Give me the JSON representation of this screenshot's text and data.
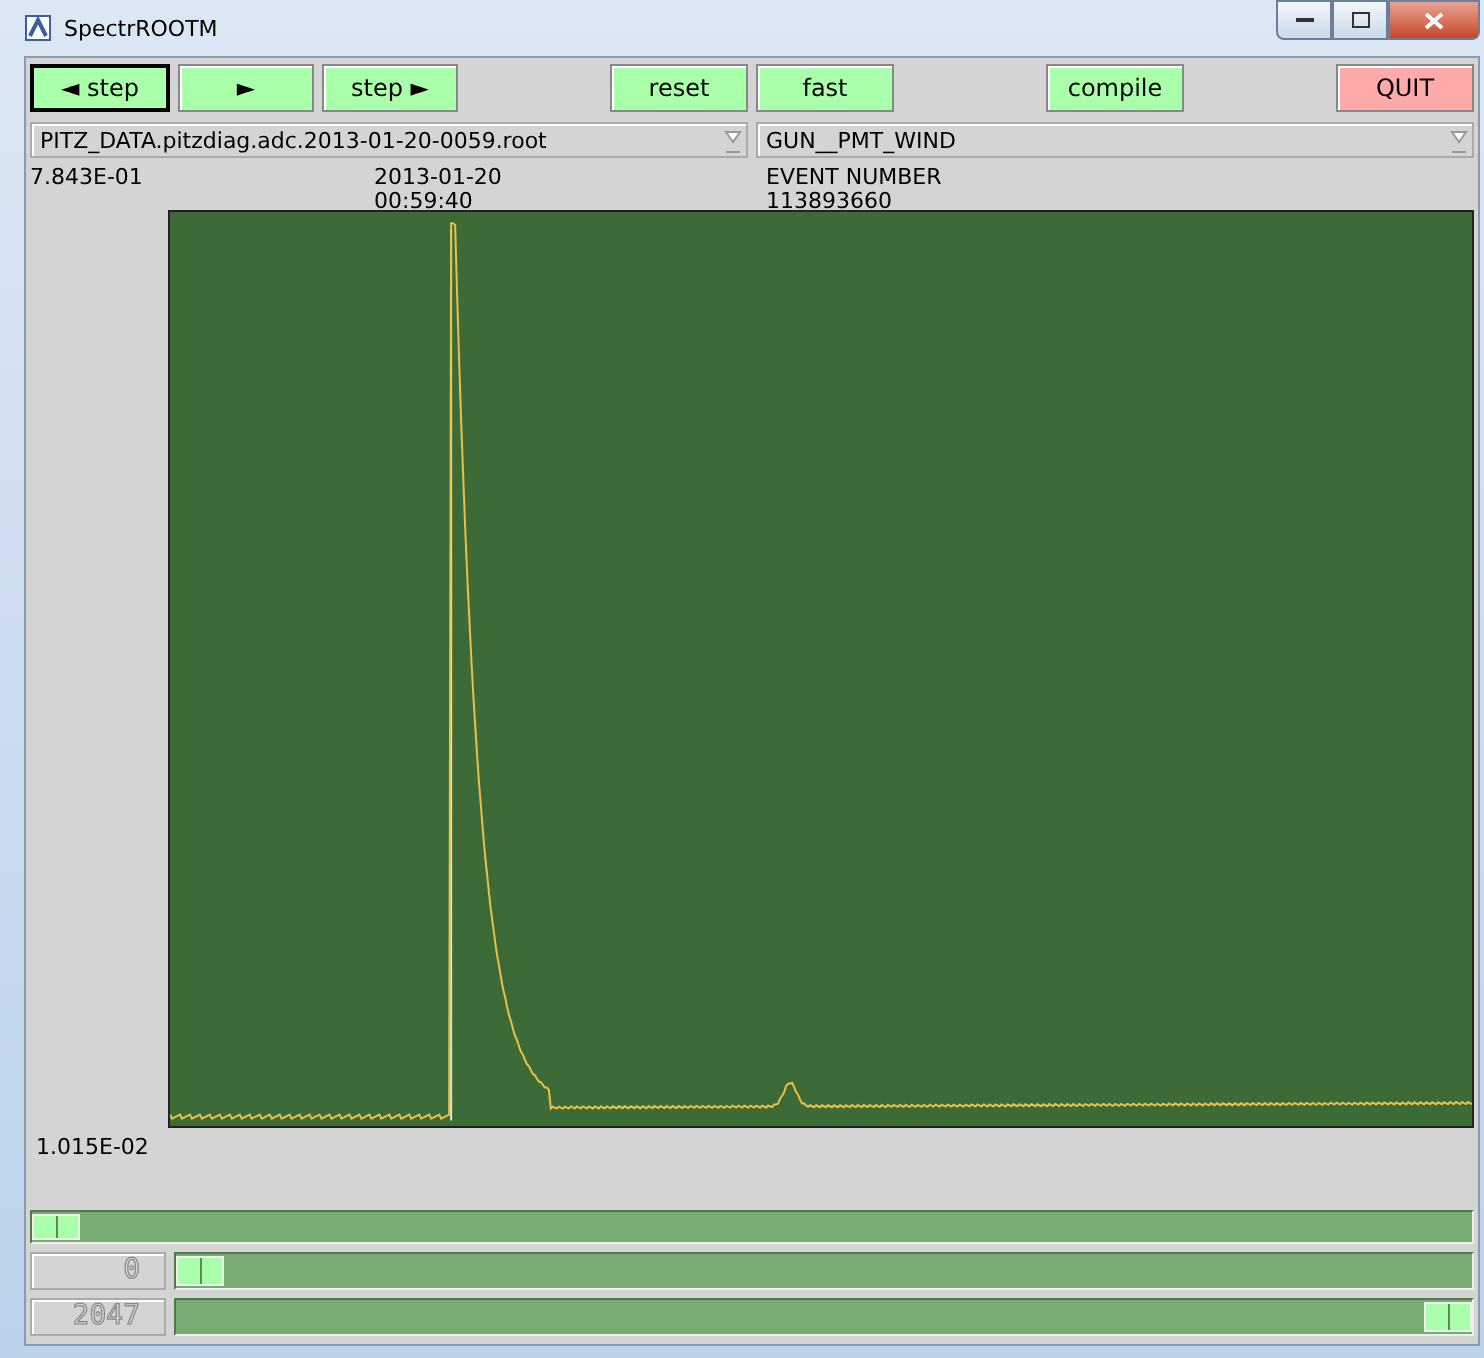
{
  "window": {
    "title": "SpectrROOTM"
  },
  "button_groups": [
    [
      {
        "label": "◄ step",
        "kind": "normal",
        "selected": true
      },
      {
        "label": "►",
        "kind": "normal",
        "selected": false
      },
      {
        "label": "step ►",
        "kind": "normal",
        "selected": false
      }
    ],
    [
      {
        "label": "reset",
        "kind": "normal",
        "selected": false
      },
      {
        "label": "fast",
        "kind": "normal",
        "selected": false
      }
    ],
    [
      {
        "label": "compile",
        "kind": "normal",
        "selected": false
      }
    ],
    [
      {
        "label": "QUIT",
        "kind": "danger",
        "selected": false
      }
    ]
  ],
  "file_select": {
    "value": "PITZ_DATA.pitzdiag.adc.2013-01-20-0059.root"
  },
  "channel_select": {
    "value": "GUN__PMT_WIND"
  },
  "plot": {
    "y_max": "7.843E-01",
    "y_min": "1.015E-02",
    "date": "2013-01-20",
    "time": "00:59:40",
    "event_label": "EVENT NUMBER",
    "event_number": "113893660"
  },
  "event_slider": {
    "level": 0
  },
  "range_sliders": [
    {
      "value": "0",
      "level": 0
    },
    {
      "value": "2047",
      "level": 1
    }
  ]
}
